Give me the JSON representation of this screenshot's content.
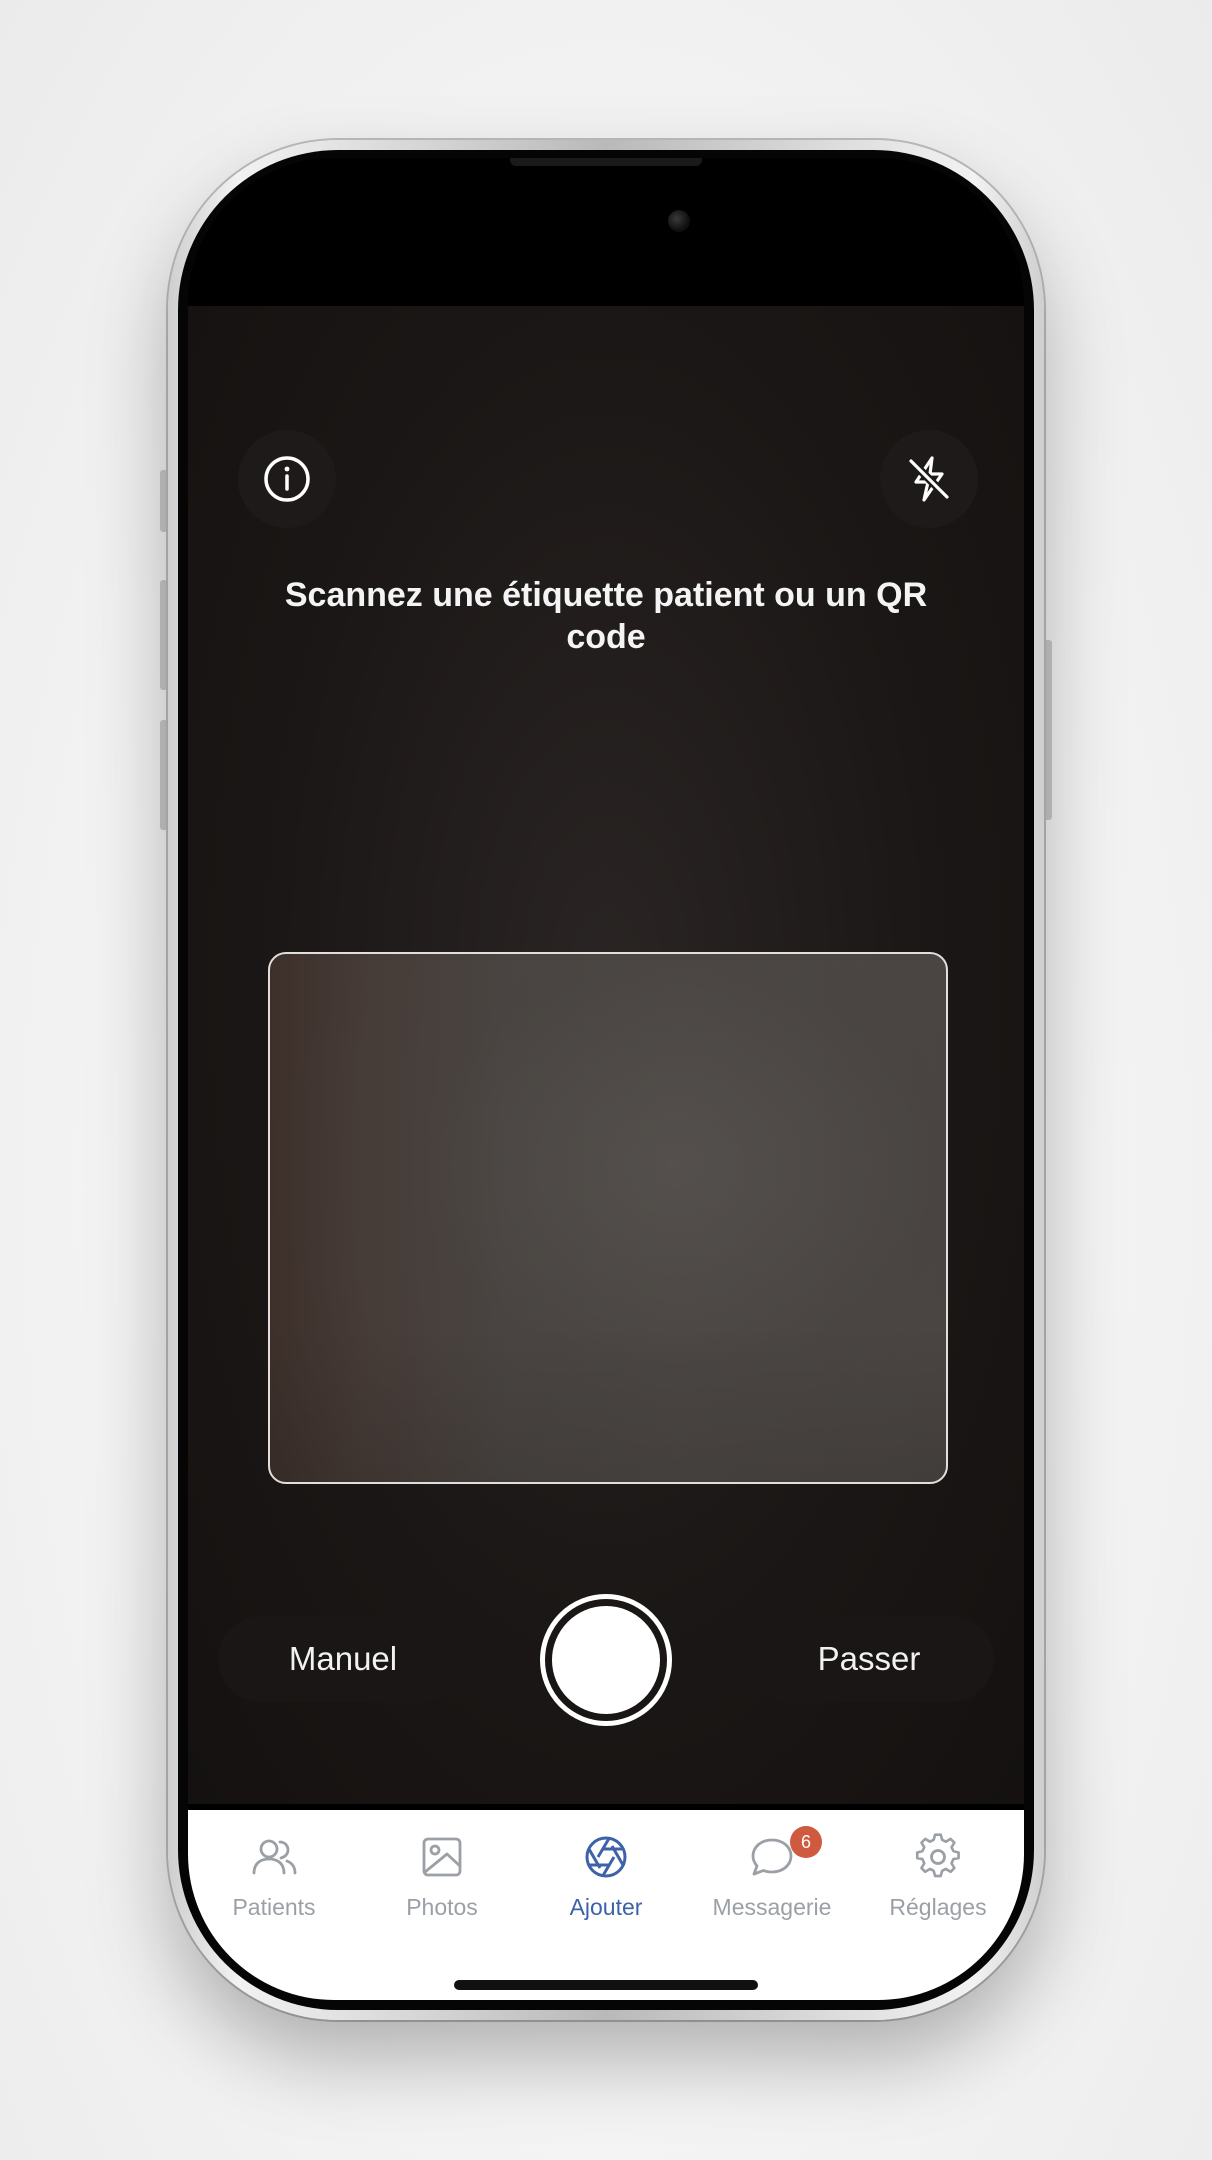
{
  "camera": {
    "instruction": "Scannez une étiquette patient ou un QR code",
    "info_icon": "info-icon",
    "flash_icon": "flash-off-icon",
    "manual_label": "Manuel",
    "skip_label": "Passer"
  },
  "tabbar": {
    "items": [
      {
        "label": "Patients",
        "icon": "users-icon"
      },
      {
        "label": "Photos",
        "icon": "image-icon"
      },
      {
        "label": "Ajouter",
        "icon": "aperture-icon",
        "active": true
      },
      {
        "label": "Messagerie",
        "icon": "chat-bubble-icon",
        "badge": "6"
      },
      {
        "label": "Réglages",
        "icon": "gear-icon"
      }
    ]
  },
  "colors": {
    "accent": "#3e62a8",
    "badge": "#d05a40",
    "inactive": "#9aa0a6",
    "camera_bg": "#1b1716"
  }
}
